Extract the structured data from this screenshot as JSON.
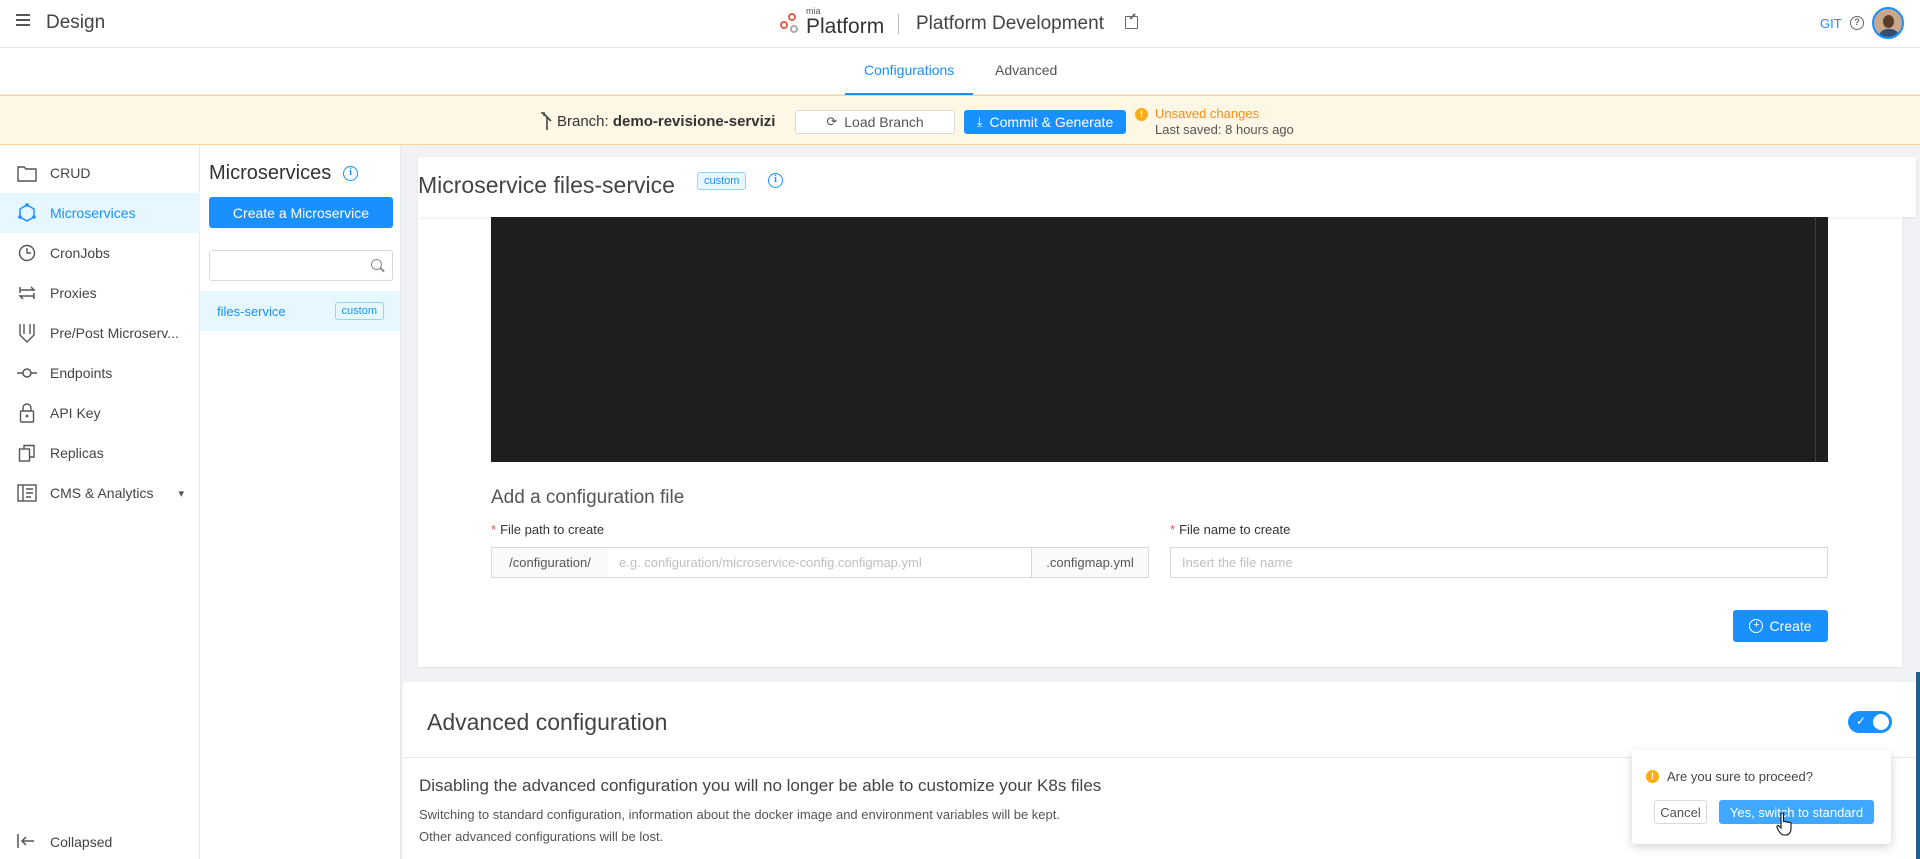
{
  "header": {
    "app_title": "Design",
    "brand_top": "mia",
    "brand": "Platform",
    "project_name": "Platform Development",
    "git_label": "GIT"
  },
  "tabs": [
    {
      "label": "Configurations",
      "active": true
    },
    {
      "label": "Advanced",
      "active": false
    }
  ],
  "branch_bar": {
    "branch_prefix": "Branch:",
    "branch_name": "demo-revisione-servizi",
    "load_branch_label": "Load Branch",
    "commit_label": "Commit & Generate",
    "unsaved_label": "Unsaved changes",
    "last_saved_label": "Last saved:",
    "last_saved_value": "8 hours ago"
  },
  "sidebar": {
    "items": [
      {
        "label": "CRUD",
        "icon": "folder-icon",
        "active": false
      },
      {
        "label": "Microservices",
        "icon": "hexagon-nodes-icon",
        "active": true
      },
      {
        "label": "CronJobs",
        "icon": "clock-icon",
        "active": false
      },
      {
        "label": "Proxies",
        "icon": "swap-icon",
        "active": false
      },
      {
        "label": "Pre/Post Microserv...",
        "icon": "filter-icon",
        "active": false
      },
      {
        "label": "Endpoints",
        "icon": "endpoint-icon",
        "active": false
      },
      {
        "label": "API Key",
        "icon": "lock-icon",
        "active": false
      },
      {
        "label": "Replicas",
        "icon": "copy-icon",
        "active": false
      },
      {
        "label": "CMS & Analytics",
        "icon": "dashboard-icon",
        "active": false
      }
    ],
    "collapsed_label": "Collapsed"
  },
  "list_panel": {
    "title": "Microservices",
    "create_label": "Create a Microservice",
    "search_placeholder": "",
    "items": [
      {
        "name": "files-service",
        "tag": "custom"
      }
    ]
  },
  "main": {
    "title": "Microservice files-service",
    "tag": "custom",
    "config_file": {
      "title": "Add a configuration file",
      "path_label": "File path to create",
      "path_prefix": "/configuration/",
      "path_placeholder": "e.g. configuration/microservice-config.configmap.yml",
      "path_suffix": ".configmap.yml",
      "name_label": "File name to create",
      "name_placeholder": "Insert the file name",
      "create_label": "Create"
    }
  },
  "advanced": {
    "title": "Advanced configuration",
    "toggle_on": true,
    "warning": "Disabling the advanced configuration you will no longer be able to customize your K8s files",
    "desc_line1": "Switching to standard configuration, information about the docker image and environment variables will be kept.",
    "desc_line2": "Other advanced configurations will be lost."
  },
  "popconfirm": {
    "question": "Are you sure to proceed?",
    "cancel_label": "Cancel",
    "confirm_label": "Yes, switch to standard"
  },
  "colors": {
    "primary": "#1890ff",
    "warning": "#faad14",
    "branch_bar_bg": "#fff7e6",
    "editor_bg": "#1e1e1e"
  }
}
